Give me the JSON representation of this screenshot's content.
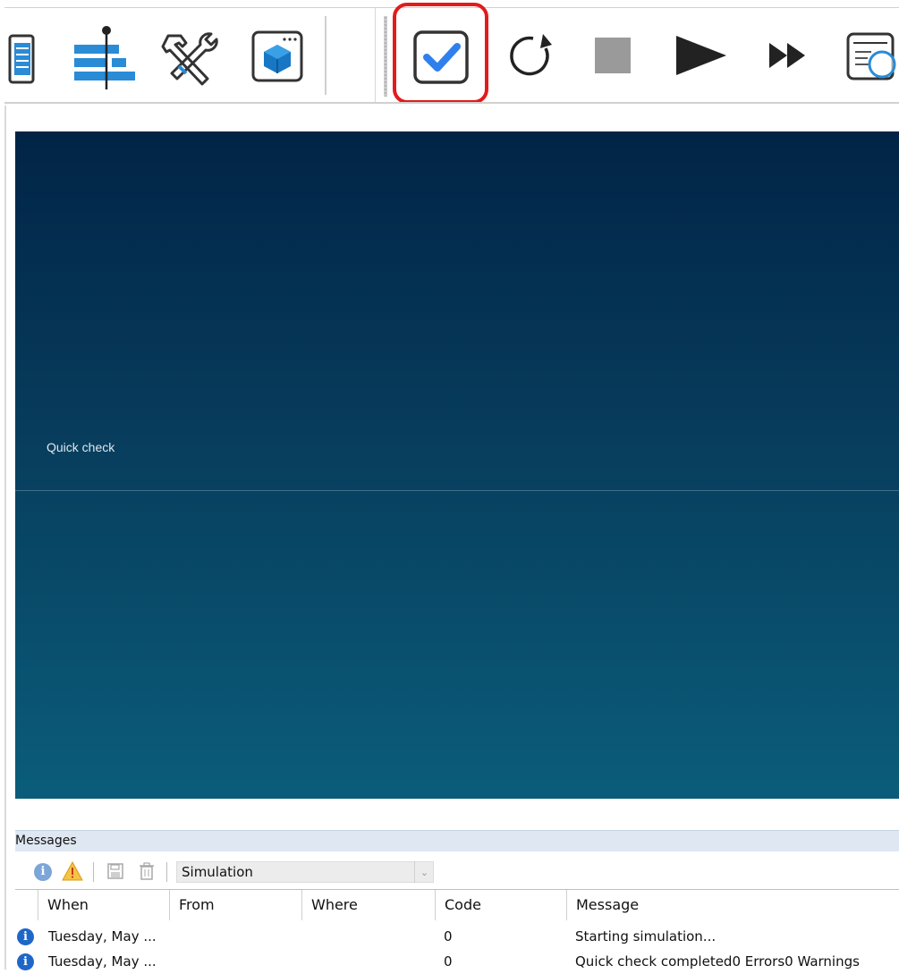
{
  "toolbar": {
    "buttons": [
      {
        "name": "clipboard-icon"
      },
      {
        "name": "gantt-icon"
      },
      {
        "name": "tools-icon"
      },
      {
        "name": "3d-window-icon"
      },
      {
        "name": "quick-check-icon"
      },
      {
        "name": "reset-icon"
      },
      {
        "name": "stop-icon"
      },
      {
        "name": "play-icon"
      },
      {
        "name": "fast-forward-icon"
      },
      {
        "name": "trace-icon"
      }
    ]
  },
  "viewer": {
    "label": "Quick check"
  },
  "messages": {
    "title": "Messages",
    "filter": {
      "selected": "Simulation"
    },
    "columns": {
      "when": "When",
      "from": "From",
      "where": "Where",
      "code": "Code",
      "message": "Message"
    },
    "rows": [
      {
        "when": "Tuesday, May ...",
        "from": "",
        "where": "",
        "code": "0",
        "message": "Starting simulation..."
      },
      {
        "when": "Tuesday, May ...",
        "from": "",
        "where": "",
        "code": "0",
        "message": "Quick check completed0 Errors0 Warnings"
      }
    ]
  },
  "colors": {
    "highlight": "#e21b1b",
    "accent_blue": "#2f80ed"
  }
}
